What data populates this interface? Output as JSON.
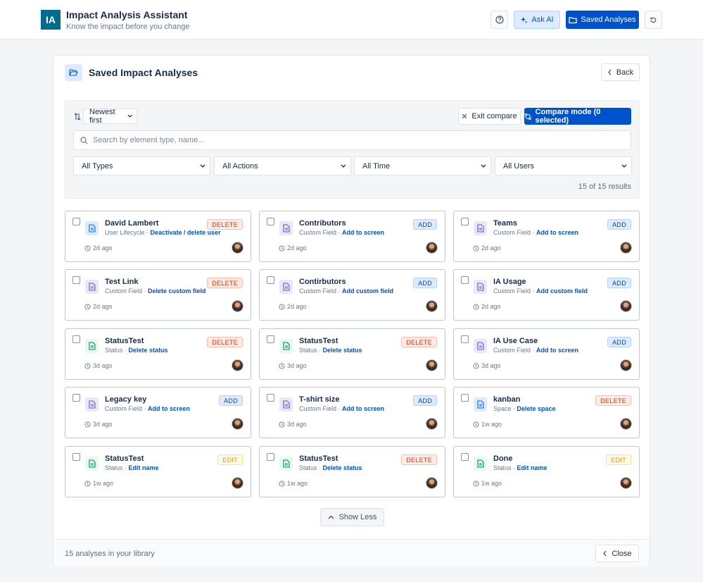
{
  "app": {
    "logo_text": "IA",
    "title": "Impact Analysis Assistant",
    "subtitle": "Know the impact before you change",
    "ask_ai_label": "Ask AI",
    "saved_analyses_label": "Saved Analyses",
    "icons": [
      "help-icon",
      "sparkle-icon",
      "folder-icon",
      "refresh-icon"
    ]
  },
  "panel": {
    "title": "Saved Impact Analyses",
    "back_label": "Back",
    "sort": {
      "selected": "Newest first"
    },
    "exit_compare_label": "Exit compare",
    "compare_mode_label": "Compare mode (0 selected)",
    "search": {
      "placeholder": "Search by element type, name...",
      "value": ""
    },
    "filters": {
      "types": "All Types",
      "actions": "All Actions",
      "time": "All Time",
      "users": "All Users"
    },
    "results_text": "15 of 15 results",
    "show_less_label": "Show Less",
    "footer_text": "15 analyses in your library",
    "close_label": "Close"
  },
  "colors": {
    "primary": "#0052cc",
    "delete": "#de350b",
    "add": "#0747a6",
    "edit": "#ff8b00"
  },
  "cards": [
    {
      "title": "David Lambert",
      "type": "User Lifecycle",
      "action": "Deactivate / delete user",
      "badge": "DELETE",
      "badge_kind": "delete",
      "icon": "blue",
      "time": "2d ago"
    },
    {
      "title": "Contributors",
      "type": "Custom Field",
      "action": "Add to screen",
      "badge": "ADD",
      "badge_kind": "add",
      "icon": "purple",
      "time": "2d ago"
    },
    {
      "title": "Teams",
      "type": "Custom Field",
      "action": "Add to screen",
      "badge": "ADD",
      "badge_kind": "add",
      "icon": "purple",
      "time": "2d ago"
    },
    {
      "title": "Test Link",
      "type": "Custom Field",
      "action": "Delete custom field",
      "badge": "DELETE",
      "badge_kind": "delete",
      "icon": "purple",
      "time": "2d ago"
    },
    {
      "title": "Contirbutors",
      "type": "Custom Field",
      "action": "Add custom field",
      "badge": "ADD",
      "badge_kind": "add",
      "icon": "purple",
      "time": "2d ago"
    },
    {
      "title": "IA Usage",
      "type": "Custom Field",
      "action": "Add custom field",
      "badge": "ADD",
      "badge_kind": "add",
      "icon": "purple",
      "time": "2d ago"
    },
    {
      "title": "StatusTest",
      "type": "Status",
      "action": "Delete status",
      "badge": "DELETE",
      "badge_kind": "delete",
      "icon": "green",
      "time": "3d ago"
    },
    {
      "title": "StatusTest",
      "type": "Status",
      "action": "Delete status",
      "badge": "DELETE",
      "badge_kind": "delete",
      "icon": "green",
      "time": "3d ago"
    },
    {
      "title": "IA Use Case",
      "type": "Custom Field",
      "action": "Add to screen",
      "badge": "ADD",
      "badge_kind": "add",
      "icon": "purple",
      "time": "3d ago"
    },
    {
      "title": "Legacy key",
      "type": "Custom Field",
      "action": "Add to screen",
      "badge": "ADD",
      "badge_kind": "add",
      "icon": "purple",
      "time": "3d ago"
    },
    {
      "title": "T-shirt size",
      "type": "Custom Field",
      "action": "Add to screen",
      "badge": "ADD",
      "badge_kind": "add",
      "icon": "purple",
      "time": "3d ago"
    },
    {
      "title": "kanban",
      "type": "Space",
      "action": "Delete space",
      "badge": "DELETE",
      "badge_kind": "delete",
      "icon": "blue",
      "time": "1w ago"
    },
    {
      "title": "StatusTest",
      "type": "Status",
      "action": "Edit name",
      "badge": "EDIT",
      "badge_kind": "edit",
      "icon": "green",
      "time": "1w ago"
    },
    {
      "title": "StatusTest",
      "type": "Status",
      "action": "Delete status",
      "badge": "DELETE",
      "badge_kind": "delete",
      "icon": "green",
      "time": "1w ago"
    },
    {
      "title": "Done",
      "type": "Status",
      "action": "Edit name",
      "badge": "EDIT",
      "badge_kind": "edit",
      "icon": "green",
      "time": "1w ago"
    }
  ]
}
